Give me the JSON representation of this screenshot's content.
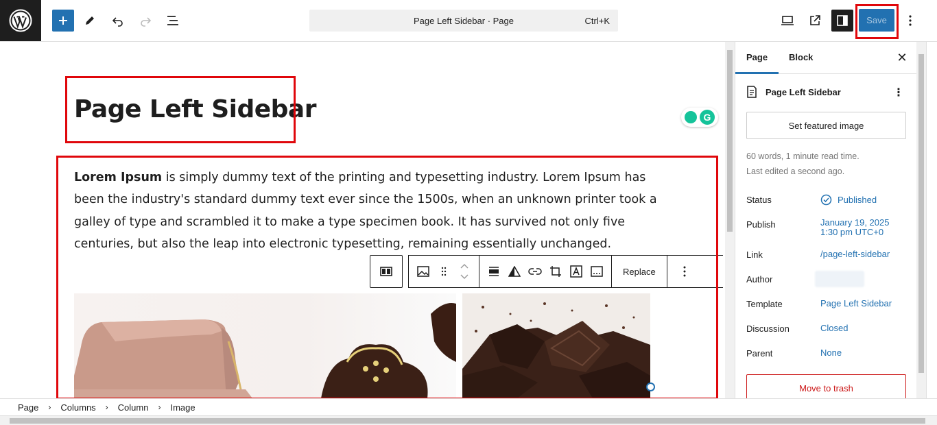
{
  "topbar": {
    "command_title": "Page Left Sidebar · Page",
    "command_shortcut": "Ctrl+K",
    "save_label": "Save"
  },
  "editor": {
    "title": "Page Left Sidebar",
    "paragraph": {
      "bold_lead": "Lorem Ipsum",
      "text": " is simply dummy text of the printing and typesetting industry. Lorem Ipsum has been the industry's standard dummy text ever since the 1500s, when an unknown printer took a galley of type and scrambled it to make a type specimen book. It has survived not only five centuries, but also the leap into electronic typesetting, remaining essentially unchanged."
    },
    "block_toolbar": {
      "replace_label": "Replace"
    }
  },
  "sidebar": {
    "tabs": [
      "Page",
      "Block"
    ],
    "active_tab": "Page",
    "doc_title": "Page Left Sidebar",
    "featured_image_button": "Set featured image",
    "meta_words": "60 words, 1 minute read time.",
    "meta_edited": "Last edited a second ago.",
    "rows": {
      "status_label": "Status",
      "status_value": "Published",
      "publish_label": "Publish",
      "publish_date": "January 19, 2025",
      "publish_time": "1:30 pm UTC+0",
      "link_label": "Link",
      "link_value": "/page-left-sidebar",
      "author_label": "Author",
      "template_label": "Template",
      "template_value": "Page Left Sidebar",
      "discussion_label": "Discussion",
      "discussion_value": "Closed",
      "parent_label": "Parent",
      "parent_value": "None"
    },
    "trash_button": "Move to trash"
  },
  "breadcrumb": [
    "Page",
    "Columns",
    "Column",
    "Image"
  ],
  "colors": {
    "accent": "#2271b1",
    "highlight_box": "#e0070b",
    "danger": "#cc1818"
  }
}
